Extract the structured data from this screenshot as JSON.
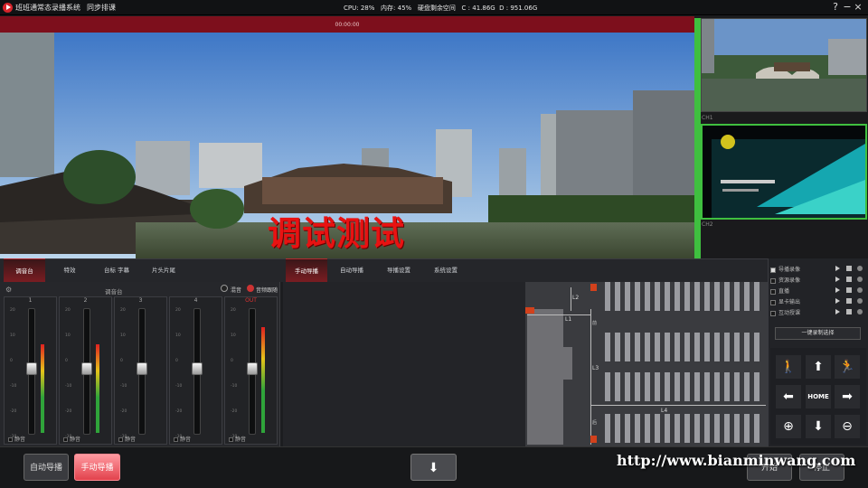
{
  "titlebar": {
    "app_title": "班班通常态录播系统",
    "menu_item": "同步排课",
    "sysinfo": "CPU: 28%   内存: 45%   硬盘剩余空间   C : 41.86G  D : 951.06G",
    "help": "?",
    "minimize": "−",
    "close": "×"
  },
  "recording": {
    "timecode": "00:00:00"
  },
  "preview": {
    "overlay_text": "调试测试"
  },
  "thumbnails": [
    {
      "label": "CH1"
    },
    {
      "label": "CH2"
    }
  ],
  "left_tabs": [
    "调音台",
    "特效",
    "台标 字幕",
    "片头片尾"
  ],
  "mixer": {
    "title": "调音台",
    "mix_label": "混音",
    "follow_label": "音频跟随",
    "channels": [
      {
        "name": "1",
        "level": 0.0,
        "meter": 0.75
      },
      {
        "name": "2",
        "level": 0.0,
        "meter": 0.75
      },
      {
        "name": "3",
        "level": 0.0,
        "meter": 0
      },
      {
        "name": "4",
        "level": 0.0,
        "meter": 0
      },
      {
        "name": "OUT",
        "level": 0.0,
        "meter": 0.9
      }
    ],
    "ticks": [
      "20",
      "10",
      "0",
      "-10",
      "-20",
      "-30"
    ],
    "mute_label": "静音"
  },
  "center_tabs": [
    "手动导播",
    "自动导播",
    "导播设置",
    "系统设置"
  ],
  "classroom": {
    "labels": [
      "L2",
      "L1",
      "L3",
      "L4",
      "前",
      "后"
    ]
  },
  "options": [
    {
      "label": "导播录像",
      "checked": true
    },
    {
      "label": "资源录像",
      "checked": false
    },
    {
      "label": "直播",
      "checked": false
    },
    {
      "label": "显卡输出",
      "checked": false
    },
    {
      "label": "互动授课",
      "checked": false
    }
  ],
  "one_key": "一键录制选择",
  "ptz": {
    "home": "HOME"
  },
  "bottom": {
    "auto_btn": "自动导播",
    "manual_btn": "手动导播",
    "start_btn": "开始",
    "stop_btn": "停止",
    "watermark": "http://www.bianminwang.com"
  },
  "colors": {
    "accent": "#b32a30",
    "red_bar": "#7d0f1c",
    "thumb_active": "#3fbf3f"
  }
}
